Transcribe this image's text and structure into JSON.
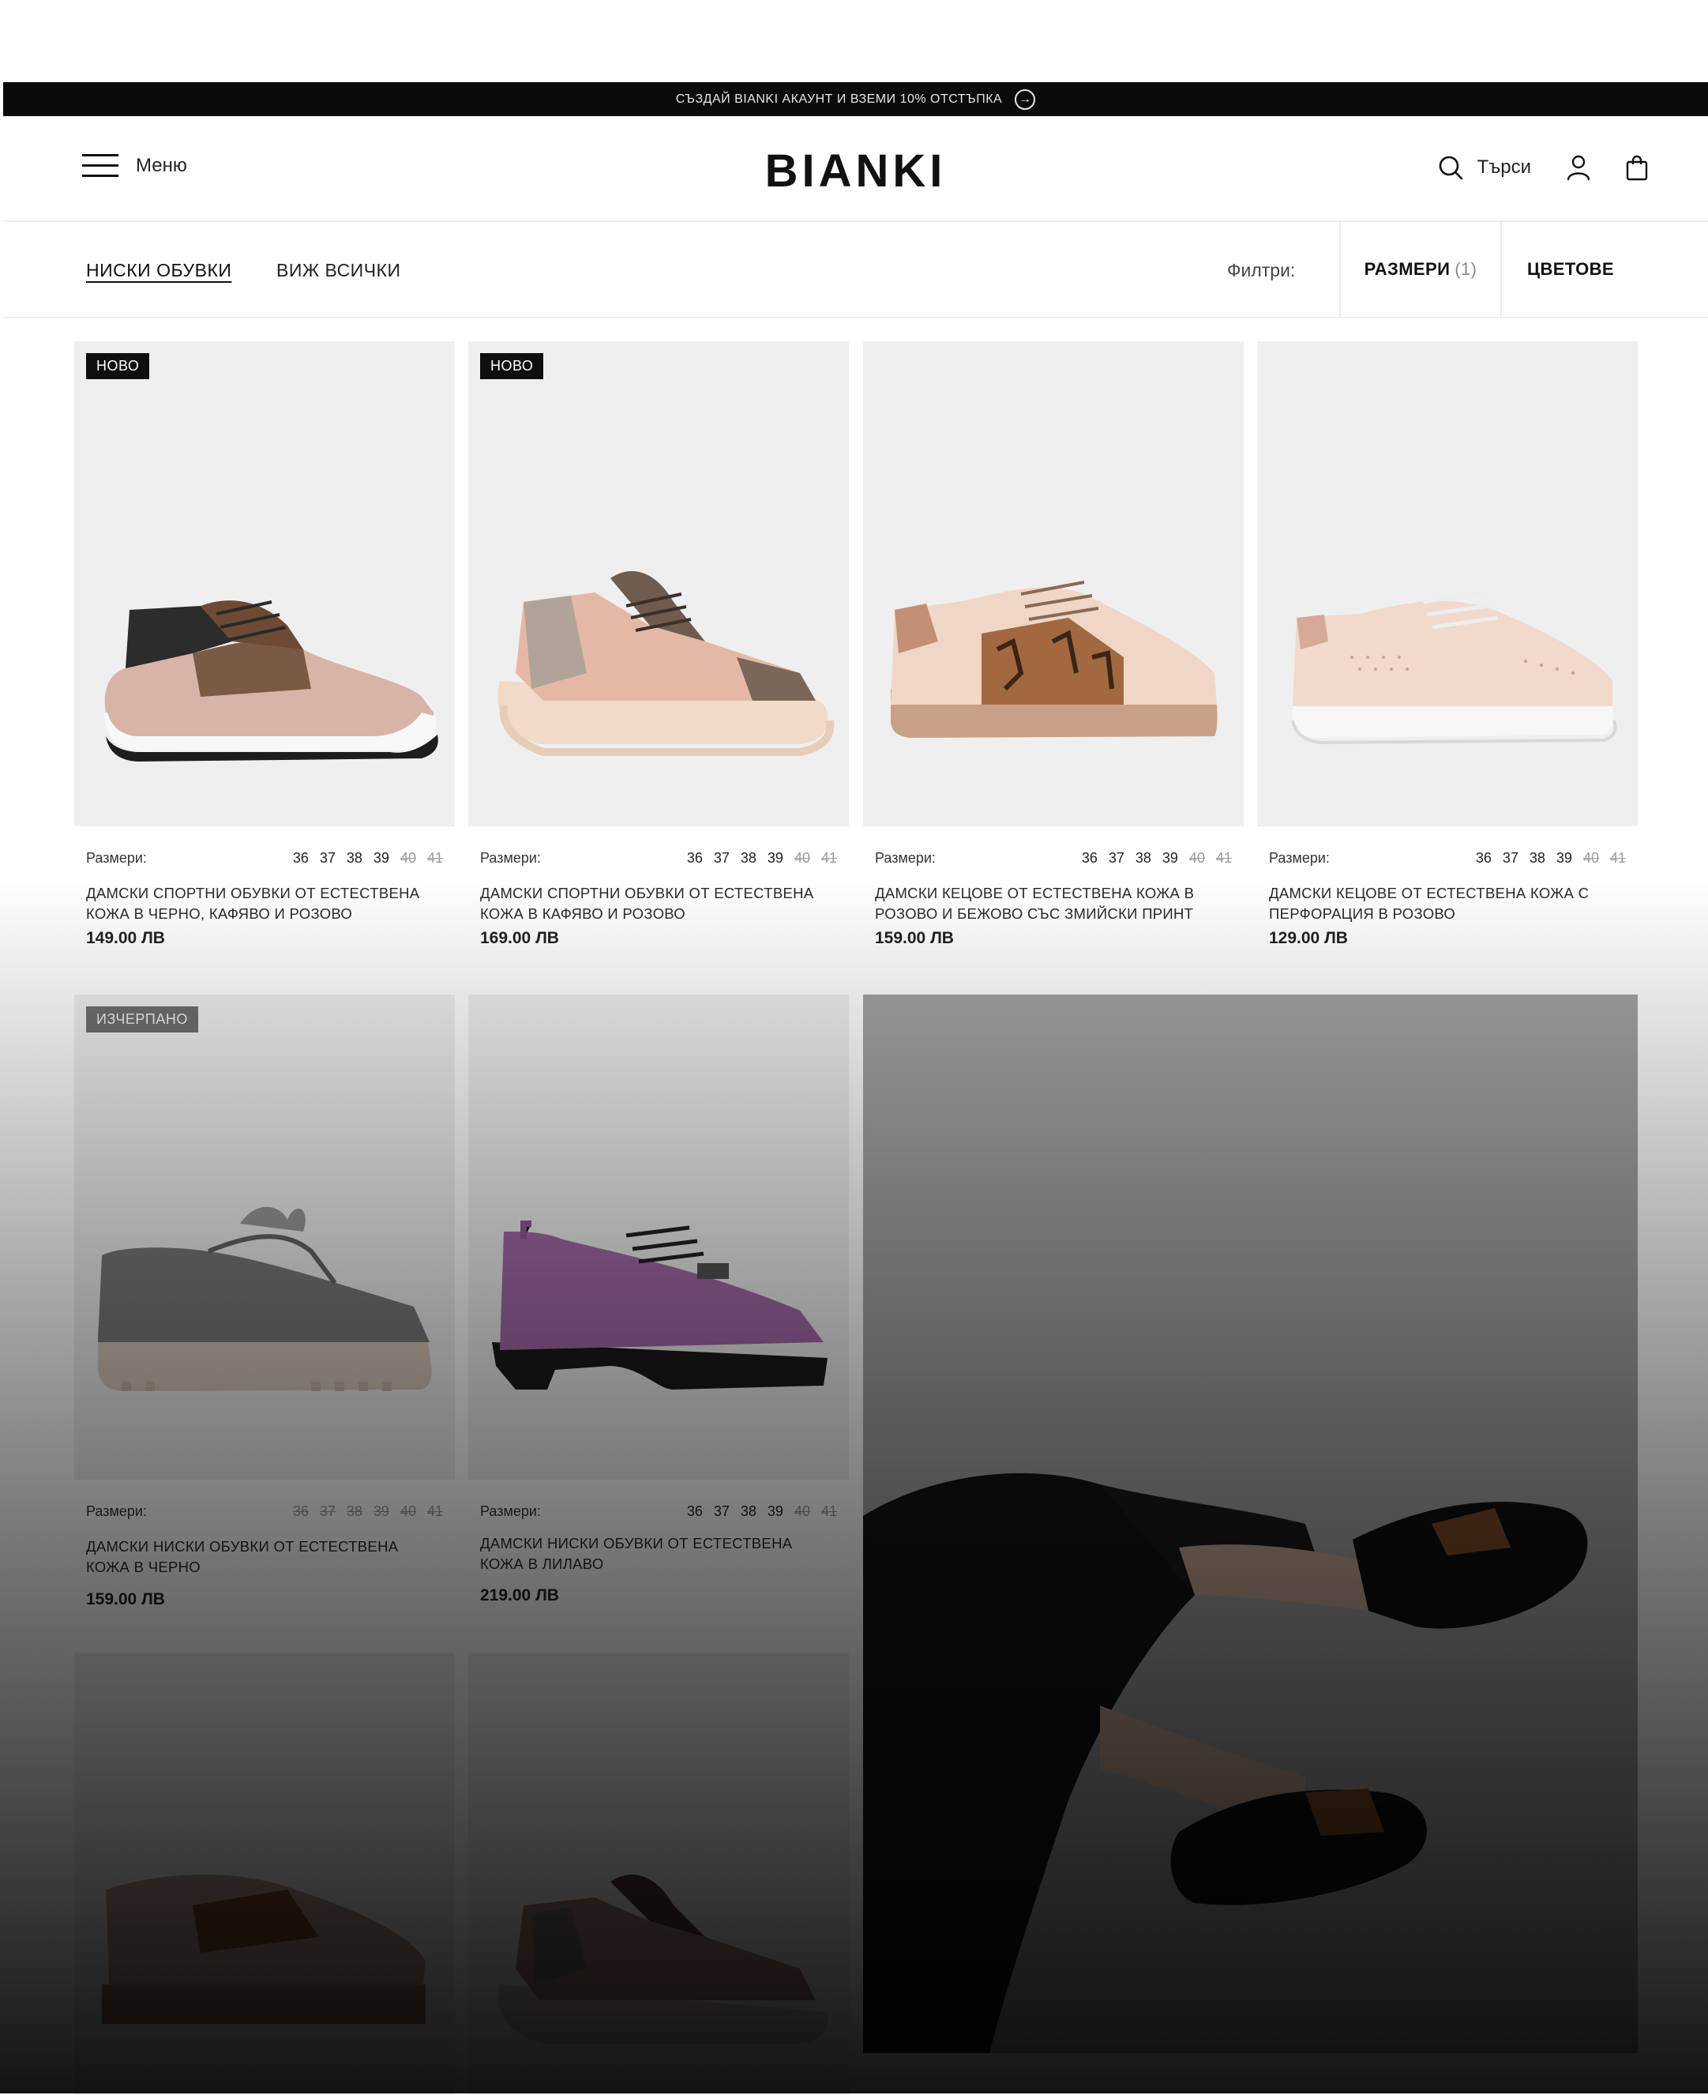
{
  "promo_bar": {
    "text": "СЪЗДАЙ BIANKI АКАУНТ И ВЗЕМИ 10% ОТСТЪПКА"
  },
  "header": {
    "menu_label": "Меню",
    "logo": "BIANKI",
    "search_label": "Търси"
  },
  "filterbar": {
    "categories": [
      "НИСКИ ОБУВКИ",
      "ВИЖ ВСИЧКИ"
    ],
    "filters_label": "Филтри:",
    "sizes_button": "РАЗМЕРИ",
    "sizes_count": "(1)",
    "colors_button": "ЦВЕТОВЕ"
  },
  "sizes_label": "Размери:",
  "products": [
    {
      "badge": "НОВО",
      "title": "ДАМСКИ СПОРТНИ ОБУВКИ ОТ ЕСТЕСТВЕНА КОЖА В ЧЕРНО, КАФЯВО И РОЗОВО",
      "price": "149.00 ЛВ",
      "sizes": [
        "36",
        "37",
        "38",
        "39",
        "40",
        "41"
      ],
      "sizes_available": [
        true,
        true,
        true,
        true,
        false,
        false
      ]
    },
    {
      "badge": "НОВО",
      "title": "ДАМСКИ СПОРТНИ ОБУВКИ ОТ ЕСТЕСТВЕНА КОЖА В КАФЯВО И РОЗОВО",
      "price": "169.00 ЛВ",
      "sizes": [
        "36",
        "37",
        "38",
        "39",
        "40",
        "41"
      ],
      "sizes_available": [
        true,
        true,
        true,
        true,
        false,
        false
      ]
    },
    {
      "badge": "",
      "title": "ДАМСКИ КЕЦОВЕ ОТ ЕСТЕСТВЕНА КОЖА В РОЗОВО И БЕЖОВО СЪС ЗМИЙСКИ ПРИНТ",
      "price": "159.00 ЛВ",
      "sizes": [
        "36",
        "37",
        "38",
        "39",
        "40",
        "41"
      ],
      "sizes_available": [
        true,
        true,
        true,
        true,
        false,
        false
      ]
    },
    {
      "badge": "",
      "title": "ДАМСКИ КЕЦОВЕ ОТ ЕСТЕСТВЕНА КОЖА С ПЕРФОРАЦИЯ В РОЗОВО",
      "price": "129.00 ЛВ",
      "sizes": [
        "36",
        "37",
        "38",
        "39",
        "40",
        "41"
      ],
      "sizes_available": [
        true,
        true,
        true,
        true,
        false,
        false
      ]
    },
    {
      "badge": "ИЗЧЕРПАНО",
      "title": "ДАМСКИ НИСКИ ОБУВКИ ОТ ЕСТЕСТВЕНА КОЖА В ЧЕРНО",
      "price": "159.00 ЛВ",
      "sizes": [
        "36",
        "37",
        "38",
        "39",
        "40",
        "41"
      ],
      "sizes_available": [
        false,
        false,
        false,
        false,
        false,
        false
      ]
    },
    {
      "badge": "",
      "title": "ДАМСКИ НИСКИ ОБУВКИ ОТ ЕСТЕСТВЕНА КОЖА В ЛИЛАВО",
      "price": "219.00 ЛВ",
      "sizes": [
        "36",
        "37",
        "38",
        "39",
        "40",
        "41"
      ],
      "sizes_available": [
        true,
        true,
        true,
        true,
        false,
        false
      ]
    }
  ],
  "colors": {
    "promo_bg": "#0b0b0b",
    "card_bg": "#efefef",
    "badge_dark": "#0f0f0f",
    "badge_gray": "#6f6f6f"
  },
  "icons": [
    "arrow-right-circle-icon",
    "hamburger-icon",
    "search-icon",
    "user-icon",
    "shopping-bag-icon"
  ]
}
